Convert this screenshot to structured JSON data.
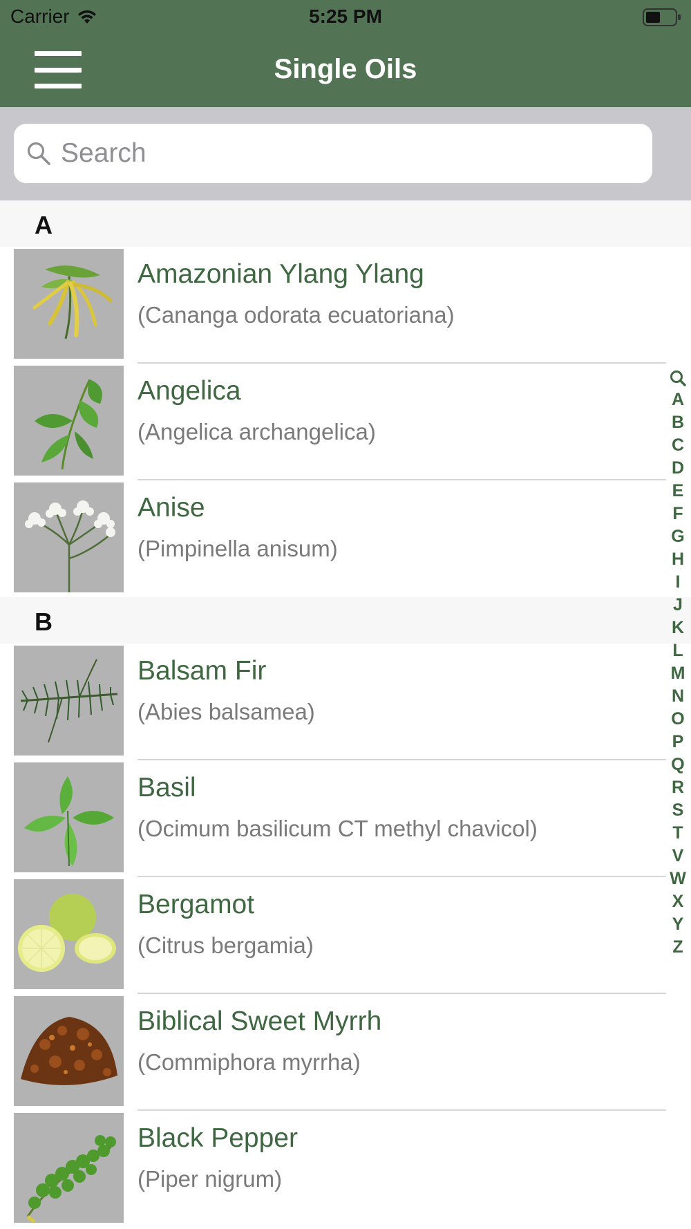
{
  "status_bar": {
    "carrier": "Carrier",
    "time": "5:25 PM"
  },
  "nav": {
    "title": "Single Oils",
    "menu_icon": "hamburger-menu-icon"
  },
  "search": {
    "placeholder": "Search",
    "value": ""
  },
  "colors": {
    "header": "#527454",
    "accent_text": "#3f6742",
    "secondary_text": "#7a7a7a",
    "search_bg": "#c8c8cc",
    "section_bg": "#f7f7f7"
  },
  "sections": [
    {
      "letter": "A",
      "items": [
        {
          "name": "Amazonian Ylang Ylang",
          "latin": "(Cananga odorata ecuatoriana)",
          "icon": "ylang-ylang-flower-image"
        },
        {
          "name": "Angelica",
          "latin": "(Angelica archangelica)",
          "icon": "angelica-leaf-image"
        },
        {
          "name": "Anise",
          "latin": "(Pimpinella anisum)",
          "icon": "anise-flower-image"
        }
      ]
    },
    {
      "letter": "B",
      "items": [
        {
          "name": "Balsam Fir",
          "latin": "(Abies balsamea)",
          "icon": "balsam-fir-branch-image"
        },
        {
          "name": "Basil",
          "latin": "(Ocimum basilicum CT methyl chavicol)",
          "icon": "basil-leaves-image"
        },
        {
          "name": "Bergamot",
          "latin": "(Citrus bergamia)",
          "icon": "bergamot-fruit-image"
        },
        {
          "name": "Biblical Sweet Myrrh",
          "latin": "(Commiphora myrrha)",
          "icon": "myrrh-resin-image"
        },
        {
          "name": "Black Pepper",
          "latin": "(Piper nigrum)",
          "icon": "black-pepper-berries-image"
        }
      ]
    }
  ],
  "section_index": [
    "A",
    "B",
    "C",
    "D",
    "E",
    "F",
    "G",
    "H",
    "I",
    "J",
    "K",
    "L",
    "M",
    "N",
    "O",
    "P",
    "Q",
    "R",
    "S",
    "T",
    "V",
    "W",
    "X",
    "Y",
    "Z"
  ]
}
